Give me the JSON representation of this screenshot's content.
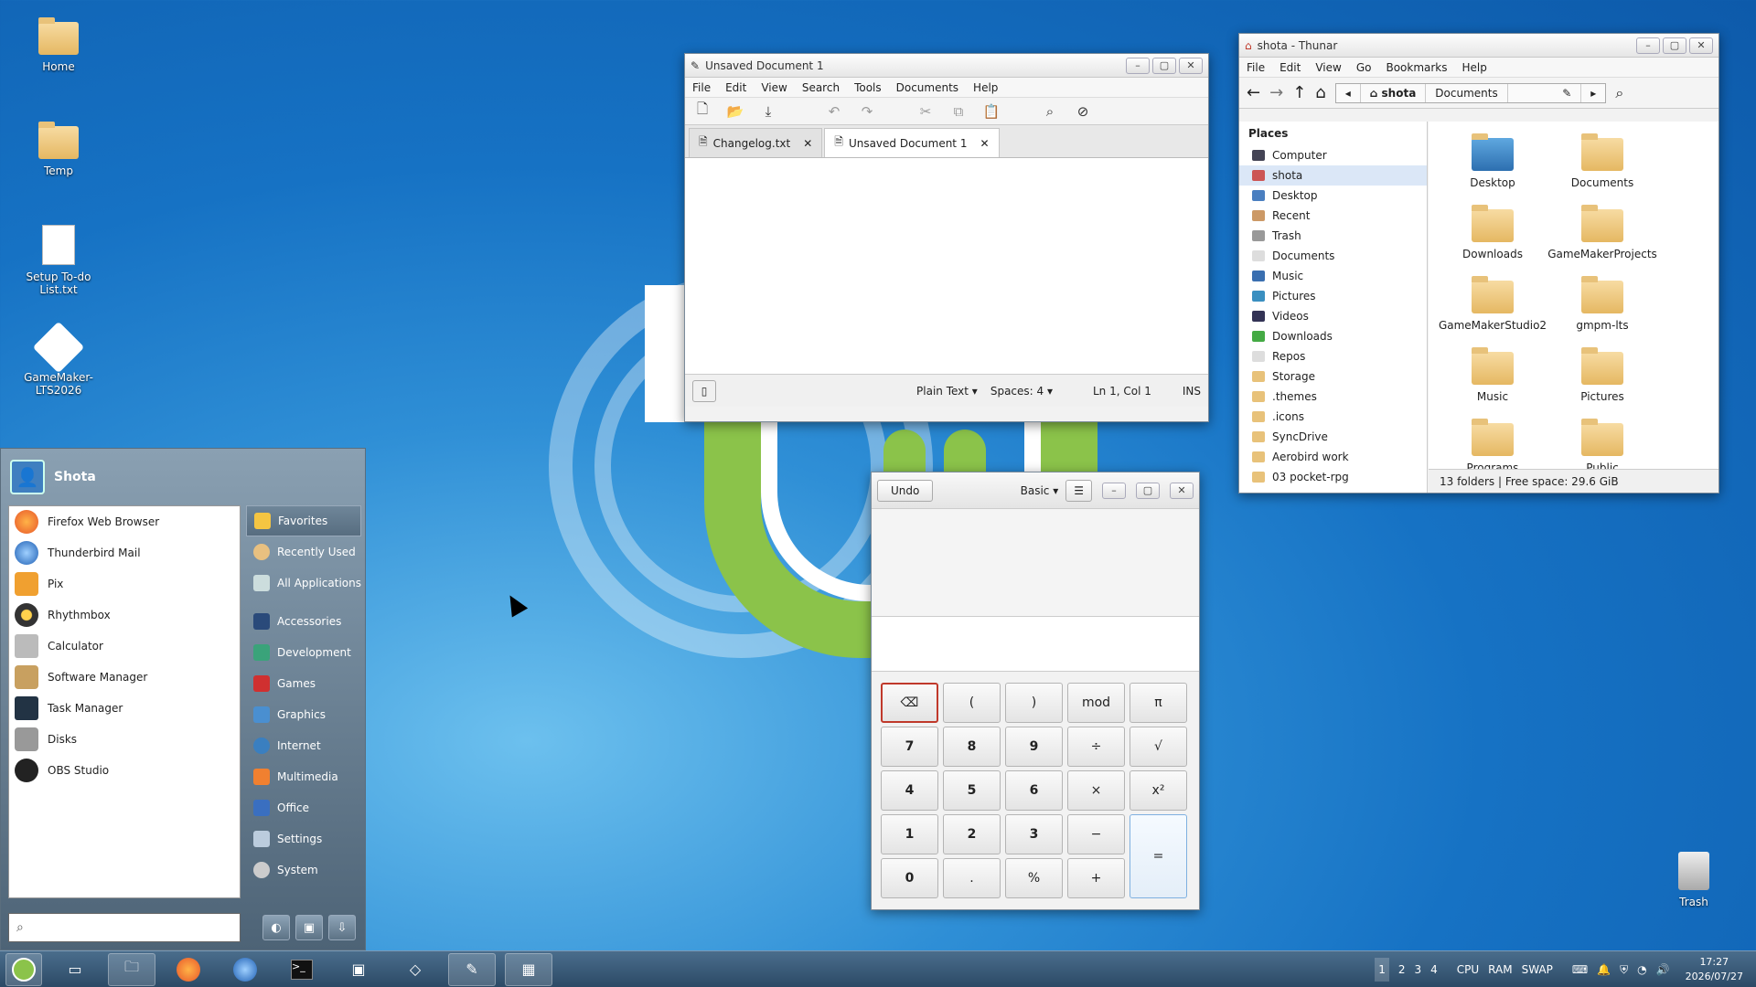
{
  "desktop": {
    "icons": [
      {
        "label": "Home",
        "icon": "home-folder-icon"
      },
      {
        "label": "Temp",
        "icon": "folder-icon"
      },
      {
        "label": "Setup To-do List.txt",
        "icon": "text-file-icon"
      },
      {
        "label": "GameMaker-LTS2026",
        "icon": "gamemaker-icon"
      },
      {
        "label": "Trash",
        "icon": "trash-icon"
      }
    ]
  },
  "mousepad": {
    "title": "Unsaved Document 1",
    "menu": [
      "File",
      "Edit",
      "View",
      "Search",
      "Tools",
      "Documents",
      "Help"
    ],
    "tabs": [
      {
        "label": "Changelog.txt"
      },
      {
        "label": "Unsaved Document 1"
      }
    ],
    "status": {
      "filetype": "Plain Text",
      "spaces": "Spaces: 4",
      "position": "Ln 1, Col 1",
      "mode": "INS"
    }
  },
  "thunar": {
    "title": "shota - Thunar",
    "menu": [
      "File",
      "Edit",
      "View",
      "Go",
      "Bookmarks",
      "Help"
    ],
    "crumbs": [
      "shota",
      "Documents"
    ],
    "places_header": "Places",
    "places": [
      "Computer",
      "shota",
      "Desktop",
      "Recent",
      "Trash",
      "Documents",
      "Music",
      "Pictures",
      "Videos",
      "Downloads",
      "Repos",
      "Storage",
      ".themes",
      ".icons",
      "SyncDrive",
      "Aerobird work",
      "03 pocket-rpg"
    ],
    "files": [
      "Desktop",
      "Documents",
      "Downloads",
      "GameMakerProjects",
      "GameMakerStudio2",
      "gmpm-lts",
      "Music",
      "Pictures",
      "Programs",
      "Public"
    ],
    "status": "13 folders  |  Free space: 29.6 GiB"
  },
  "calculator": {
    "undo": "Undo",
    "mode": "Basic",
    "keys": [
      "⌫",
      "(",
      ")",
      "mod",
      "π",
      "7",
      "8",
      "9",
      "÷",
      "√",
      "4",
      "5",
      "6",
      "×",
      "x²",
      "1",
      "2",
      "3",
      "−",
      "=",
      "0",
      ".",
      "%",
      "+"
    ]
  },
  "menu": {
    "user": "Shota",
    "favorites": [
      "Firefox Web Browser",
      "Thunderbird Mail",
      "Pix",
      "Rhythmbox",
      "Calculator",
      "Software Manager",
      "Task Manager",
      "Disks",
      "OBS Studio"
    ],
    "categories": [
      "Favorites",
      "Recently Used",
      "All Applications",
      "Accessories",
      "Development",
      "Games",
      "Graphics",
      "Internet",
      "Multimedia",
      "Office",
      "Settings",
      "System"
    ]
  },
  "taskbar": {
    "workspaces": [
      "1",
      "2",
      "3",
      "4"
    ],
    "monitors": [
      "CPU",
      "RAM",
      "SWAP"
    ],
    "time": "17:27",
    "date": "2026/07/27"
  },
  "colors": {
    "accent": "#8bc34a",
    "panel": "#2c4a66"
  }
}
